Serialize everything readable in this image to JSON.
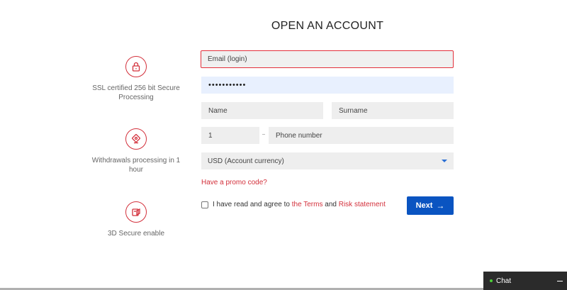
{
  "page_title": "OPEN AN ACCOUNT",
  "features": [
    {
      "icon": "lock-icon",
      "text": "SSL certified 256 bit Secure Processing"
    },
    {
      "icon": "money-withdraw-icon",
      "text": "Withdrawals processing in 1 hour"
    },
    {
      "icon": "secure-card-icon",
      "text": "3D Secure enable"
    }
  ],
  "form": {
    "email_placeholder": "Email (login)",
    "password_value": "•••••••••••",
    "name_placeholder": "Name",
    "surname_placeholder": "Surname",
    "phone_code_value": "1",
    "phone_placeholder": "Phone number",
    "currency_selected": "USD (Account currency)",
    "promo_link": "Have a promo code?",
    "agree_prefix": "I have read and agree to ",
    "terms_link": "the Terms",
    "agree_and": " and ",
    "risk_link": "Risk statement",
    "next_label": "Next",
    "next_arrow": "→"
  },
  "chat": {
    "label": "Chat"
  },
  "colors": {
    "accent_red": "#d3303b",
    "button_blue": "#0a54c1",
    "chat_bg": "#2b2b2b"
  }
}
